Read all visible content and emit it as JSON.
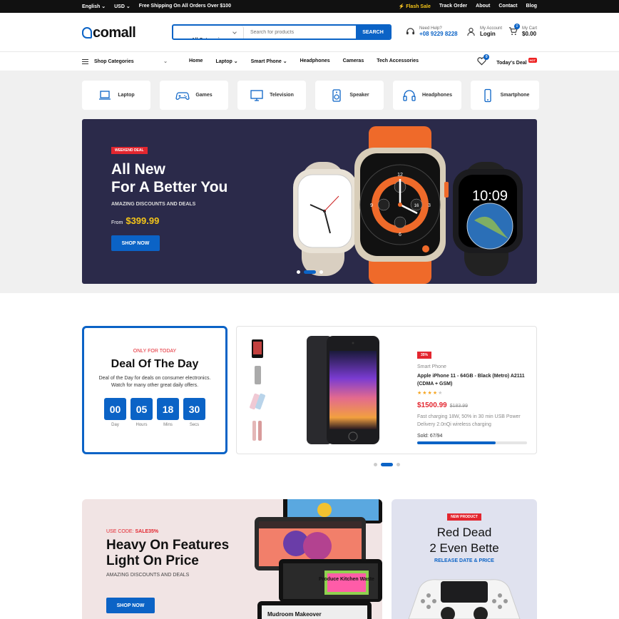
{
  "topbar": {
    "language": "English",
    "currency": "USD",
    "shipping": "Free Shipping On All Orders Over $100",
    "flash": "⚡ Flash Sale",
    "links": [
      "Track Order",
      "About",
      "Contact",
      "Blog"
    ]
  },
  "header": {
    "logo": "comall",
    "search_category": "All Categories",
    "search_placeholder": "Search for products",
    "search_button": "SEARCH",
    "help_label": "Need Help?",
    "help_phone": "+08 9229 8228",
    "account_label": "My Account",
    "account_action": "Login",
    "cart_label": "My Cart",
    "cart_total": "$0.00",
    "cart_count": "0"
  },
  "nav": {
    "shop_categories": "Shop Categories",
    "links": [
      "Home",
      "Laptop",
      "Smart Phone",
      "Headphones",
      "Cameras",
      "Tech Accessories"
    ],
    "wishlist_count": "0",
    "todays_deal": "Today's Deal",
    "hot": "HOT"
  },
  "categories": [
    "Laptop",
    "Games",
    "Television",
    "Speaker",
    "Headphones",
    "Smartphone"
  ],
  "hero": {
    "badge": "WEEKEND DEAL",
    "title_line1": "All New",
    "title_line2": "For A Better You",
    "subtitle": "AMAZING DISCOUNTS AND DEALS",
    "price_prefix": "From",
    "price": "$399.99",
    "button": "SHOP NOW",
    "watch_time": "10:09",
    "watch_numbers": [
      "12",
      "3",
      "6",
      "9",
      "16"
    ]
  },
  "deal": {
    "tag": "ONLY FOR TODAY",
    "title": "Deal Of The Day",
    "text": "Deal of the Day for deals on consumer electronics. Watch for many other great daily offers.",
    "timer": [
      {
        "value": "00",
        "unit": "Day"
      },
      {
        "value": "05",
        "unit": "Hours"
      },
      {
        "value": "18",
        "unit": "Mins"
      },
      {
        "value": "30",
        "unit": "Secs"
      }
    ]
  },
  "product": {
    "discount": "35%",
    "category": "Smart Phone",
    "name": "Apple iPhone 11 - 64GB - Black (Metro) A2111 (CDMA + GSM)",
    "rating": 4,
    "rating_max": 5,
    "price": "$1500.99",
    "old_price": "$183.99",
    "description": "Fast charging 18W, 50% in 30 min USB Power Delivery 2.0nQi wireless charging",
    "sold_label": "Sold: 67/94",
    "sold_fraction": 0.713
  },
  "banner1": {
    "code_label": "USE CODE:",
    "code": "SALE35%",
    "title_line1": "Heavy On Features",
    "title_line2": "Light On Price",
    "subtitle": "AMAZING DISCOUNTS AND DEALS",
    "button": "SHOP NOW",
    "tablet_text": "Mudroom Makeover",
    "tablet_sticker": "Produce Kitchen Waste"
  },
  "banner2": {
    "badge": "NEW PRODUCT",
    "title_line1": "Red Dead",
    "title_line2": "2 Even Bette",
    "subtitle": "RELEASE DATE & PRICE"
  },
  "colors": {
    "primary": "#0b63c6",
    "accent": "#e3262f",
    "hero_bg": "#2b2a4a",
    "price_yellow": "#f5c518"
  }
}
